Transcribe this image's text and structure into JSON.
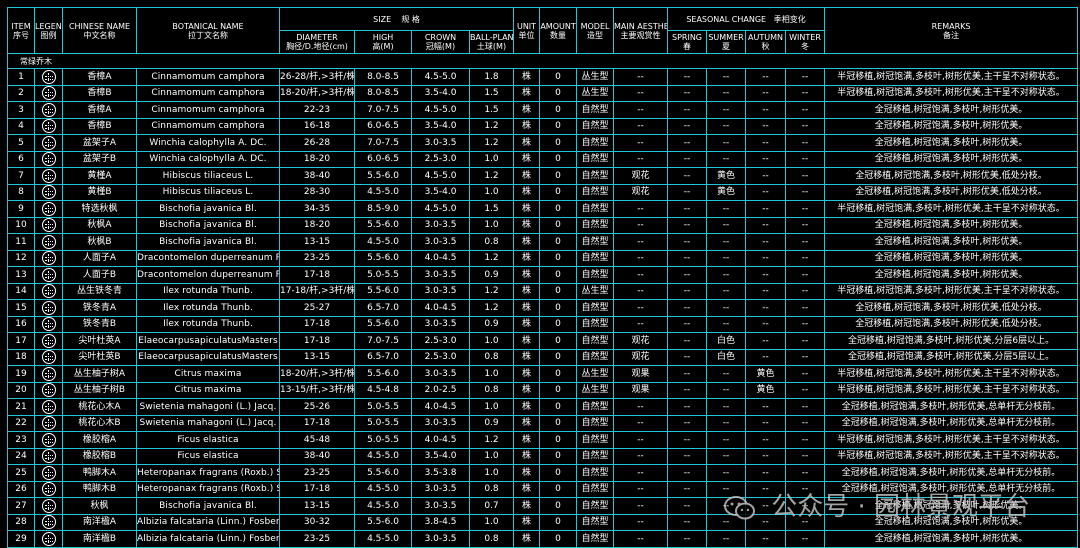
{
  "headers": {
    "item": [
      "ITEM",
      "序号"
    ],
    "legend": [
      "LEGEND",
      "图例"
    ],
    "chinese_name": [
      "CHINESE NAME",
      "中文名称"
    ],
    "botanical_name": [
      "BOTANICAL NAME",
      "拉丁文名称"
    ],
    "size": [
      "SIZE",
      "规  格"
    ],
    "diameter": [
      "DIAMETER",
      "胸径/D.地径(cm)"
    ],
    "high": [
      "HIGH",
      "高(M)"
    ],
    "crown": [
      "CROWN",
      "冠幅(M)"
    ],
    "ball_plant": [
      "BALL-PLANT",
      "土球(M)"
    ],
    "unit": [
      "UNIT",
      "单位"
    ],
    "amount": [
      "AMOUNT",
      "数量"
    ],
    "model": [
      "MODEL",
      "造型"
    ],
    "main_aesthetics": [
      "MAIN AESTHETICS",
      "主要观赏性"
    ],
    "seasonal": [
      "SEASONAL CHANGE",
      "季相变化"
    ],
    "spring": [
      "SPRING",
      "春"
    ],
    "summer": [
      "SUMMER",
      "夏"
    ],
    "autumn": [
      "AUTUMN",
      "秋"
    ],
    "winter": [
      "WINTER",
      "冬"
    ],
    "remarks": [
      "REMARKS",
      "备注"
    ]
  },
  "category": "常绿乔木",
  "legend_icon": "tree-symbol-icon",
  "rows": [
    {
      "item": "1",
      "cn": "香樟A",
      "bot": "Cinnamomum camphora",
      "dia": "26-28/杆,>3杆/株",
      "hi": "8.0-8.5",
      "cr": "4.5-5.0",
      "bp": "1.8",
      "unit": "株",
      "amt": "0",
      "model": "丛生型",
      "aes": "--",
      "sp": "--",
      "su": "--",
      "au": "--",
      "wi": "--",
      "rem": "半冠移植,树冠饱满,多枝叶,树形优美,主干呈不对称状态。"
    },
    {
      "item": "2",
      "cn": "香樟B",
      "bot": "Cinnamomum camphora",
      "dia": "18-20/杆,>3杆/株",
      "hi": "8.0-8.5",
      "cr": "3.5-4.0",
      "bp": "1.5",
      "unit": "株",
      "amt": "0",
      "model": "丛生型",
      "aes": "--",
      "sp": "--",
      "su": "--",
      "au": "--",
      "wi": "--",
      "rem": "半冠移植,树冠饱满,多枝叶,树形优美,主干呈不对称状态。"
    },
    {
      "item": "3",
      "cn": "香樟A",
      "bot": "Cinnamomum camphora",
      "dia": "22-23",
      "hi": "7.0-7.5",
      "cr": "4.5-5.0",
      "bp": "1.5",
      "unit": "株",
      "amt": "0",
      "model": "自然型",
      "aes": "--",
      "sp": "--",
      "su": "--",
      "au": "--",
      "wi": "--",
      "rem": "全冠移植,树冠饱满,多枝叶,树形优美。"
    },
    {
      "item": "4",
      "cn": "香樟B",
      "bot": "Cinnamomum camphora",
      "dia": "16-18",
      "hi": "6.0-6.5",
      "cr": "3.5-4.0",
      "bp": "1.2",
      "unit": "株",
      "amt": "0",
      "model": "自然型",
      "aes": "--",
      "sp": "--",
      "su": "--",
      "au": "--",
      "wi": "--",
      "rem": "全冠移植,树冠饱满,多枝叶,树形优美。"
    },
    {
      "item": "5",
      "cn": "盆架子A",
      "bot": "Winchia calophylla A. DC.",
      "dia": "26-28",
      "hi": "7.0-7.5",
      "cr": "3.0-3.5",
      "bp": "1.2",
      "unit": "株",
      "amt": "0",
      "model": "自然型",
      "aes": "--",
      "sp": "--",
      "su": "--",
      "au": "--",
      "wi": "--",
      "rem": "全冠移植,树冠饱满,多枝叶,树形优美。"
    },
    {
      "item": "6",
      "cn": "盆架子B",
      "bot": "Winchia calophylla A. DC.",
      "dia": "18-20",
      "hi": "6.0-6.5",
      "cr": "2.5-3.0",
      "bp": "1.0",
      "unit": "株",
      "amt": "0",
      "model": "自然型",
      "aes": "--",
      "sp": "--",
      "su": "--",
      "au": "--",
      "wi": "--",
      "rem": "全冠移植,树冠饱满,多枝叶,树形优美。"
    },
    {
      "item": "7",
      "cn": "黄槿A",
      "bot": "Hibiscus tiliaceus L.",
      "dia": "38-40",
      "hi": "5.5-6.0",
      "cr": "4.5-5.0",
      "bp": "1.2",
      "unit": "株",
      "amt": "0",
      "model": "自然型",
      "aes": "观花",
      "sp": "--",
      "su": "黄色",
      "au": "--",
      "wi": "--",
      "rem": "全冠移植,树冠饱满,多枝叶,树形优美,低处分枝。"
    },
    {
      "item": "8",
      "cn": "黄槿B",
      "bot": "Hibiscus tiliaceus L.",
      "dia": "28-30",
      "hi": "4.5-5.0",
      "cr": "3.5-4.0",
      "bp": "1.0",
      "unit": "株",
      "amt": "0",
      "model": "自然型",
      "aes": "观花",
      "sp": "--",
      "su": "黄色",
      "au": "--",
      "wi": "--",
      "rem": "全冠移植,树冠饱满,多枝叶,树形优美,低处分枝。"
    },
    {
      "item": "9",
      "cn": "特选秋枫",
      "bot": "Bischofia javanica Bl.",
      "dia": "34-35",
      "hi": "8.5-9.0",
      "cr": "4.5-5.0",
      "bp": "1.5",
      "unit": "株",
      "amt": "0",
      "model": "自然型",
      "aes": "--",
      "sp": "--",
      "su": "--",
      "au": "--",
      "wi": "--",
      "rem": "半冠移植,树冠饱满,多枝叶,树形优美,主干呈不对称状态。"
    },
    {
      "item": "10",
      "cn": "秋枫A",
      "bot": "Bischofia javanica Bl.",
      "dia": "18-20",
      "hi": "5.5-6.0",
      "cr": "3.0-3.5",
      "bp": "1.0",
      "unit": "株",
      "amt": "0",
      "model": "自然型",
      "aes": "--",
      "sp": "--",
      "su": "--",
      "au": "--",
      "wi": "--",
      "rem": "全冠移植,树冠饱满,多枝叶,树形优美。"
    },
    {
      "item": "11",
      "cn": "秋枫B",
      "bot": "Bischofia javanica Bl.",
      "dia": "13-15",
      "hi": "4.5-5.0",
      "cr": "3.0-3.5",
      "bp": "0.8",
      "unit": "株",
      "amt": "0",
      "model": "自然型",
      "aes": "--",
      "sp": "--",
      "su": "--",
      "au": "--",
      "wi": "--",
      "rem": "全冠移植,树冠饱满,多枝叶,树形优美。"
    },
    {
      "item": "12",
      "cn": "人面子A",
      "bot": "Dracontomelon duperreanum Pierre",
      "dia": "23-25",
      "hi": "5.5-6.0",
      "cr": "4.0-4.5",
      "bp": "1.2",
      "unit": "株",
      "amt": "0",
      "model": "自然型",
      "aes": "--",
      "sp": "--",
      "su": "--",
      "au": "--",
      "wi": "--",
      "rem": "全冠移植,树冠饱满,多枝叶,树形优美。"
    },
    {
      "item": "13",
      "cn": "人面子B",
      "bot": "Dracontomelon duperreanum Pierre",
      "dia": "17-18",
      "hi": "5.0-5.5",
      "cr": "3.0-3.5",
      "bp": "0.9",
      "unit": "株",
      "amt": "0",
      "model": "自然型",
      "aes": "--",
      "sp": "--",
      "su": "--",
      "au": "--",
      "wi": "--",
      "rem": "全冠移植,树冠饱满,多枝叶,树形优美。"
    },
    {
      "item": "14",
      "cn": "丛生铁冬青",
      "bot": "Ilex rotunda Thunb.",
      "dia": "17-18/杆,>3杆/株",
      "hi": "5.5-6.0",
      "cr": "3.0-3.5",
      "bp": "1.2",
      "unit": "株",
      "amt": "0",
      "model": "丛生型",
      "aes": "--",
      "sp": "--",
      "su": "--",
      "au": "--",
      "wi": "--",
      "rem": "半冠移植,树冠饱满,多枝叶,树形优美,主干呈不对称状态。"
    },
    {
      "item": "15",
      "cn": "铁冬青A",
      "bot": "Ilex rotunda Thunb.",
      "dia": "25-27",
      "hi": "6.5-7.0",
      "cr": "4.0-4.5",
      "bp": "1.2",
      "unit": "株",
      "amt": "0",
      "model": "自然型",
      "aes": "--",
      "sp": "--",
      "su": "--",
      "au": "--",
      "wi": "--",
      "rem": "全冠移植,树冠饱满,多枝叶,树形优美,低处分枝。"
    },
    {
      "item": "16",
      "cn": "铁冬青B",
      "bot": "Ilex rotunda Thunb.",
      "dia": "17-18",
      "hi": "5.5-6.0",
      "cr": "3.0-3.5",
      "bp": "0.9",
      "unit": "株",
      "amt": "0",
      "model": "自然型",
      "aes": "--",
      "sp": "--",
      "su": "--",
      "au": "--",
      "wi": "--",
      "rem": "全冠移植,树冠饱满,多枝叶,树形优美,低处分枝。"
    },
    {
      "item": "17",
      "cn": "尖叶杜英A",
      "bot": "ElaeocarpusapiculatusMasters",
      "dia": "17-18",
      "hi": "7.0-7.5",
      "cr": "2.5-3.0",
      "bp": "1.0",
      "unit": "株",
      "amt": "0",
      "model": "自然型",
      "aes": "观花",
      "sp": "--",
      "su": "白色",
      "au": "--",
      "wi": "--",
      "rem": "全冠移植,树冠饱满,多枝叶,树形优美,分层6层以上。"
    },
    {
      "item": "18",
      "cn": "尖叶杜英B",
      "bot": "ElaeocarpusapiculatusMasters",
      "dia": "13-15",
      "hi": "6.5-7.0",
      "cr": "2.5-3.0",
      "bp": "0.8",
      "unit": "株",
      "amt": "0",
      "model": "自然型",
      "aes": "观花",
      "sp": "--",
      "su": "白色",
      "au": "--",
      "wi": "--",
      "rem": "全冠移植,树冠饱满,多枝叶,树形优美,分层5层以上。"
    },
    {
      "item": "19",
      "cn": "丛生柚子树A",
      "bot": "Citrus maxima",
      "dia": "18-20/杆,>3杆/株",
      "hi": "5.5-6.0",
      "cr": "3.0-3.5",
      "bp": "1.0",
      "unit": "株",
      "amt": "0",
      "model": "丛生型",
      "aes": "观果",
      "sp": "--",
      "su": "--",
      "au": "黄色",
      "wi": "--",
      "rem": "半冠移植,树冠饱满,多枝叶,树形优美,主干呈不对称状态。"
    },
    {
      "item": "20",
      "cn": "丛生柚子树B",
      "bot": "Citrus maxima",
      "dia": "13-15/杆,>3杆/株",
      "hi": "4.5-4.8",
      "cr": "2.0-2.5",
      "bp": "0.8",
      "unit": "株",
      "amt": "0",
      "model": "丛生型",
      "aes": "观果",
      "sp": "--",
      "su": "--",
      "au": "黄色",
      "wi": "--",
      "rem": "半冠移植,树冠饱满,多枝叶,树形优美,主干呈不对称状态。"
    },
    {
      "item": "21",
      "cn": "桃花心木A",
      "bot": "Swietenia mahagoni (L.) Jacq.",
      "dia": "25-26",
      "hi": "5.0-5.5",
      "cr": "4.0-4.5",
      "bp": "1.0",
      "unit": "株",
      "amt": "0",
      "model": "自然型",
      "aes": "--",
      "sp": "--",
      "su": "--",
      "au": "--",
      "wi": "--",
      "rem": "全冠移植,树冠饱满,多枝叶,树形优美,总单杆无分枝前。"
    },
    {
      "item": "22",
      "cn": "桃花心木B",
      "bot": "Swietenia mahagoni (L.) Jacq.",
      "dia": "17-18",
      "hi": "5.0-5.5",
      "cr": "3.0-3.5",
      "bp": "0.9",
      "unit": "株",
      "amt": "0",
      "model": "自然型",
      "aes": "--",
      "sp": "--",
      "su": "--",
      "au": "--",
      "wi": "--",
      "rem": "全冠移植,树冠饱满,多枝叶,树形优美,总单杆无分枝前。"
    },
    {
      "item": "23",
      "cn": "橡胶榕A",
      "bot": "Ficus elastica",
      "dia": "45-48",
      "hi": "5.0-5.5",
      "cr": "4.0-4.5",
      "bp": "1.2",
      "unit": "株",
      "amt": "0",
      "model": "自然型",
      "aes": "--",
      "sp": "--",
      "su": "--",
      "au": "--",
      "wi": "--",
      "rem": "半冠移植,树冠饱满,多枝叶,树形优美,主干呈不对称状态。"
    },
    {
      "item": "24",
      "cn": "橡胶榕B",
      "bot": "Ficus elastica",
      "dia": "38-40",
      "hi": "4.5-5.0",
      "cr": "3.5-4.0",
      "bp": "1.0",
      "unit": "株",
      "amt": "0",
      "model": "自然型",
      "aes": "--",
      "sp": "--",
      "su": "--",
      "au": "--",
      "wi": "--",
      "rem": "半冠移植,树冠饱满,多枝叶,树形优美,主干呈不对称状态。"
    },
    {
      "item": "25",
      "cn": "鸭脚木A",
      "bot": "Heteropanax fragrans (Roxb.) Seem",
      "dia": "23-25",
      "hi": "5.5-6.0",
      "cr": "3.5-3.8",
      "bp": "1.0",
      "unit": "株",
      "amt": "0",
      "model": "自然型",
      "aes": "--",
      "sp": "--",
      "su": "--",
      "au": "--",
      "wi": "--",
      "rem": "全冠移植,树冠饱满,多枝叶,树形优美,总单杆无分枝前。"
    },
    {
      "item": "26",
      "cn": "鸭脚木B",
      "bot": "Heteropanax fragrans (Roxb.) Seem",
      "dia": "17-18",
      "hi": "4.5-5.0",
      "cr": "3.0-3.5",
      "bp": "0.8",
      "unit": "株",
      "amt": "0",
      "model": "自然型",
      "aes": "--",
      "sp": "--",
      "su": "--",
      "au": "--",
      "wi": "--",
      "rem": "全冠移植,树冠饱满,多枝叶,树形优美,总单杆无分枝前。"
    },
    {
      "item": "27",
      "cn": "秋枫",
      "bot": "Bischofia javanica Bl.",
      "dia": "13-15",
      "hi": "4.5-5.0",
      "cr": "3.0-3.5",
      "bp": "0.7",
      "unit": "株",
      "amt": "0",
      "model": "自然型",
      "aes": "--",
      "sp": "--",
      "su": "--",
      "au": "--",
      "wi": "--",
      "rem": "全冠移植,树冠饱满,多枝叶,树形优美。"
    },
    {
      "item": "28",
      "cn": "南洋楹A",
      "bot": "Albizia falcataria (Linn.) Fosberg",
      "dia": "30-32",
      "hi": "5.5-6.0",
      "cr": "3.8-4.5",
      "bp": "1.0",
      "unit": "株",
      "amt": "0",
      "model": "自然型",
      "aes": "--",
      "sp": "--",
      "su": "--",
      "au": "--",
      "wi": "--",
      "rem": "全冠移植,树冠饱满,多枝叶,树形优美。"
    },
    {
      "item": "29",
      "cn": "南洋楹B",
      "bot": "Albizia falcataria (Linn.) Fosberg",
      "dia": "23-25",
      "hi": "4.5-5.0",
      "cr": "3.0-3.5",
      "bp": "0.8",
      "unit": "株",
      "amt": "0",
      "model": "自然型",
      "aes": "--",
      "sp": "--",
      "su": "--",
      "au": "--",
      "wi": "--",
      "rem": "全冠移植,树冠饱满,多枝叶,树形优美。"
    }
  ],
  "watermark": "公众号 · 园林景观平台",
  "colors": {
    "background": "#000000",
    "grid": "#22c6d6",
    "text": "#ffffff",
    "watermark": "#bfbfbf"
  }
}
